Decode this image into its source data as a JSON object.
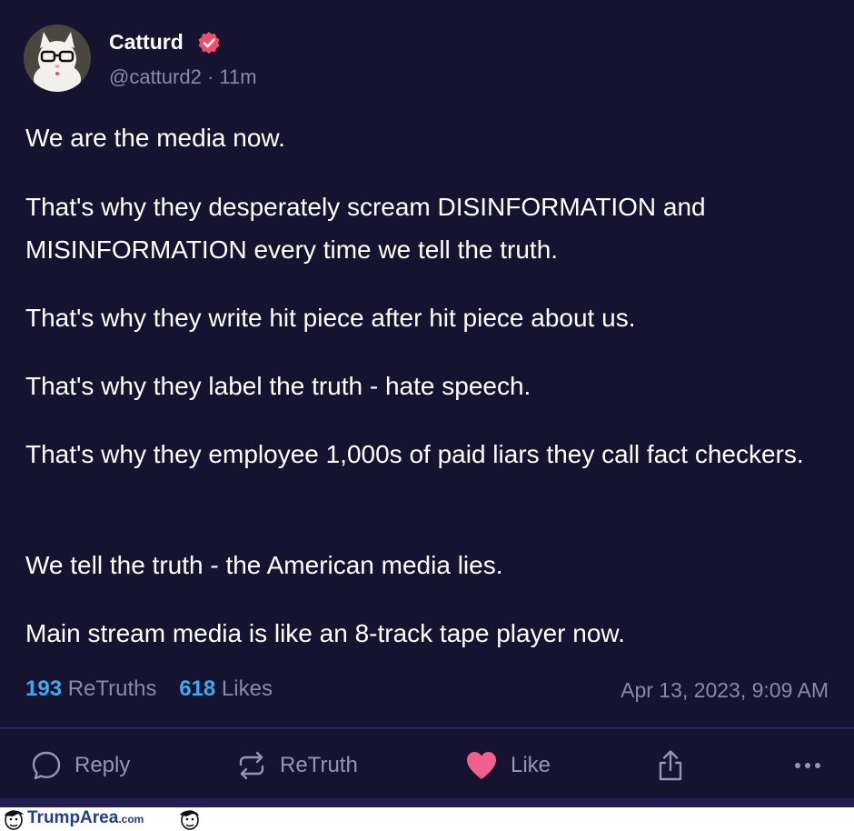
{
  "post": {
    "author_name": "Catturd",
    "handle": "@catturd2",
    "separator": "·",
    "time_ago": "11m",
    "paragraphs": [
      "We are the media now.",
      "That's why they desperately scream DISINFORMATION and MISINFORMATION every time we tell the truth.",
      "That's why they write hit piece after hit piece about us.",
      "That's why they label the truth - hate speech.",
      "That's why they employee 1,000s of paid liars they call fact checkers.",
      "We tell the truth - the American media lies.",
      "Main stream media is like an 8-track tape player now."
    ],
    "retruth_count": "193",
    "retruth_label": "ReTruths",
    "like_count": "618",
    "like_label": "Likes",
    "timestamp": "Apr 13, 2023, 9:09 AM"
  },
  "actions": {
    "reply": "Reply",
    "retruth": "ReTruth",
    "like": "Like"
  },
  "icons": {
    "verified": "verified-badge-icon",
    "reply": "speech-bubble-icon",
    "retruth": "retruth-arrows-icon",
    "like": "heart-icon",
    "share": "share-upload-icon",
    "more": "more-dots-icon"
  },
  "colors": {
    "background": "#151330",
    "link_blue": "#3fa9ef",
    "muted": "#8b8aa3",
    "heart_pink": "#f35f8b",
    "verified_pink": "#f04e6e"
  },
  "watermark": {
    "site": "TrumpArea",
    "suffix": ".com"
  }
}
